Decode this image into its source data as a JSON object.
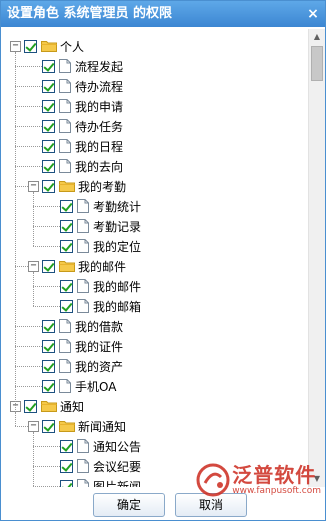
{
  "dialog": {
    "title": "设置角色 系统管理员 的权限",
    "close_glyph": "×"
  },
  "tree": [
    {
      "id": "personal",
      "label": "个人",
      "level": 0,
      "type": "folder",
      "expanded": true,
      "checked": true
    },
    {
      "id": "flow-start",
      "label": "流程发起",
      "level": 1,
      "type": "file",
      "checked": true
    },
    {
      "id": "flow-todo",
      "label": "待办流程",
      "level": 1,
      "type": "file",
      "checked": true
    },
    {
      "id": "my-apply",
      "label": "我的申请",
      "level": 1,
      "type": "file",
      "checked": true
    },
    {
      "id": "todo-task",
      "label": "待办任务",
      "level": 1,
      "type": "file",
      "checked": true
    },
    {
      "id": "my-schedule",
      "label": "我的日程",
      "level": 1,
      "type": "file",
      "checked": true
    },
    {
      "id": "my-whereabouts",
      "label": "我的去向",
      "level": 1,
      "type": "file",
      "checked": true
    },
    {
      "id": "my-attendance",
      "label": "我的考勤",
      "level": 1,
      "type": "folder",
      "expanded": true,
      "checked": true
    },
    {
      "id": "attendance-stats",
      "label": "考勤统计",
      "level": 2,
      "type": "file",
      "checked": true
    },
    {
      "id": "attendance-record",
      "label": "考勤记录",
      "level": 2,
      "type": "file",
      "checked": true
    },
    {
      "id": "my-location",
      "label": "我的定位",
      "level": 2,
      "type": "file",
      "checked": true
    },
    {
      "id": "my-mail",
      "label": "我的邮件",
      "level": 1,
      "type": "folder",
      "expanded": true,
      "checked": true
    },
    {
      "id": "my-mail-item",
      "label": "我的邮件",
      "level": 2,
      "type": "file",
      "checked": true
    },
    {
      "id": "my-mailbox",
      "label": "我的邮箱",
      "level": 2,
      "type": "file",
      "checked": true
    },
    {
      "id": "my-loan",
      "label": "我的借款",
      "level": 1,
      "type": "file",
      "checked": true
    },
    {
      "id": "my-cert",
      "label": "我的证件",
      "level": 1,
      "type": "file",
      "checked": true
    },
    {
      "id": "my-asset",
      "label": "我的资产",
      "level": 1,
      "type": "file",
      "checked": true
    },
    {
      "id": "mobile-oa",
      "label": "手机OA",
      "level": 1,
      "type": "file",
      "checked": true
    },
    {
      "id": "notice",
      "label": "通知",
      "level": 0,
      "type": "folder",
      "expanded": true,
      "checked": true
    },
    {
      "id": "news-notice",
      "label": "新闻通知",
      "level": 1,
      "type": "folder",
      "expanded": true,
      "checked": true
    },
    {
      "id": "notice-bulletin",
      "label": "通知公告",
      "level": 2,
      "type": "file",
      "checked": true
    },
    {
      "id": "meeting-minutes",
      "label": "会议纪要",
      "level": 2,
      "type": "file",
      "checked": true
    },
    {
      "id": "photo-news",
      "label": "图片新闻",
      "level": 2,
      "type": "file",
      "checked": true
    }
  ],
  "buttons": {
    "ok": "确定",
    "cancel": "取消"
  },
  "watermark": {
    "brand": "泛普软件",
    "url": "www.fanpusoft.com"
  },
  "colors": {
    "titlebar": "#3c86d2",
    "check": "#21a121",
    "folder": "#f5c94a",
    "watermark": "#cc2a1e"
  }
}
